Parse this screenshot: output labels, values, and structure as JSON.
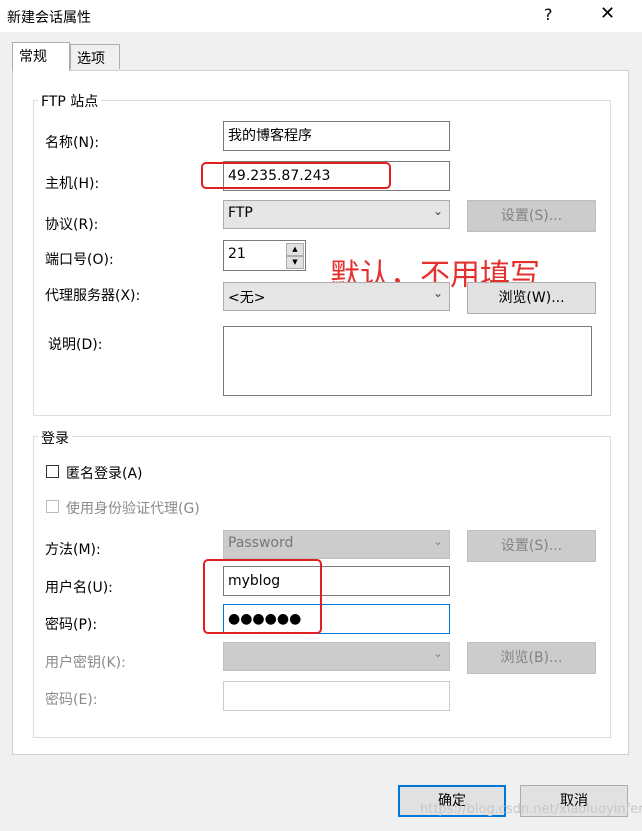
{
  "window": {
    "title": "新建会话属性",
    "help_glyph": "?",
    "close_glyph": "✕"
  },
  "tabs": [
    {
      "label": "常规"
    },
    {
      "label": "选项"
    }
  ],
  "ftp_site": {
    "group_label": "FTP 站点",
    "name_label": "名称(N):",
    "name_value": "我的博客程序",
    "host_label": "主机(H):",
    "host_value": "49.235.87.243",
    "protocol_label": "协议(R):",
    "protocol_value": "FTP",
    "settings_button": "设置(S)...",
    "port_label": "端口号(O):",
    "port_value": "21",
    "proxy_label": "代理服务器(X):",
    "proxy_value": "<无>",
    "browse_button": "浏览(W)...",
    "desc_label": "说明(D):",
    "desc_value": ""
  },
  "annotation": "默认，不用填写",
  "login": {
    "group_label": "登录",
    "anonymous_label": "匿名登录(A)",
    "auth_proxy_label": "使用身份验证代理(G)",
    "method_label": "方法(M):",
    "method_value": "Password",
    "settings_button": "设置(S)...",
    "username_label": "用户名(U):",
    "username_value": "myblog",
    "password_label": "密码(P):",
    "password_value": "●●●●●●",
    "userkey_label": "用户密钥(K):",
    "userkey_value": "",
    "browse_button": "浏览(B)...",
    "passphrase_label": "密码(E):",
    "passphrase_value": ""
  },
  "footer": {
    "ok_button": "确定",
    "cancel_button": "取消",
    "watermark": "https://blog.csdn.net/xiaoluoyinfeng"
  },
  "colors": {
    "highlight_red": "#e02020",
    "annotation_red": "#e53030",
    "focus_blue": "#0078d7"
  }
}
